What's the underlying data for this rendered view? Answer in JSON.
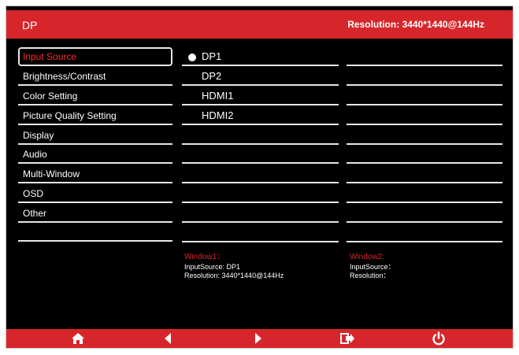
{
  "header": {
    "input_source": "DP",
    "resolution": "Resolution: 3440*1440@144Hz"
  },
  "menu": {
    "items": [
      {
        "label": "Input Source",
        "selected": true
      },
      {
        "label": "Brightness/Contrast"
      },
      {
        "label": "Color Setting"
      },
      {
        "label": "Picture Quality Setting"
      },
      {
        "label": "Display"
      },
      {
        "label": "Audio"
      },
      {
        "label": "Multi-Window"
      },
      {
        "label": "OSD"
      },
      {
        "label": "Other"
      },
      {
        "label": ""
      }
    ]
  },
  "options": [
    {
      "label": "DP1",
      "selected": true
    },
    {
      "label": "DP2"
    },
    {
      "label": "HDMI1"
    },
    {
      "label": "HDMI2"
    }
  ],
  "window1": {
    "title": "Window1：",
    "input": "InputSource: DP1",
    "resolution": "Resolution: 3440*1440@144Hz"
  },
  "window2": {
    "title": "Window2:",
    "input": "InputSource：",
    "resolution": "Resolution："
  },
  "controls": {
    "icons": [
      "home-icon",
      "arrow-left-icon",
      "arrow-right-icon",
      "enter-icon",
      "power-icon"
    ],
    "accent_color": "#d7262b"
  }
}
